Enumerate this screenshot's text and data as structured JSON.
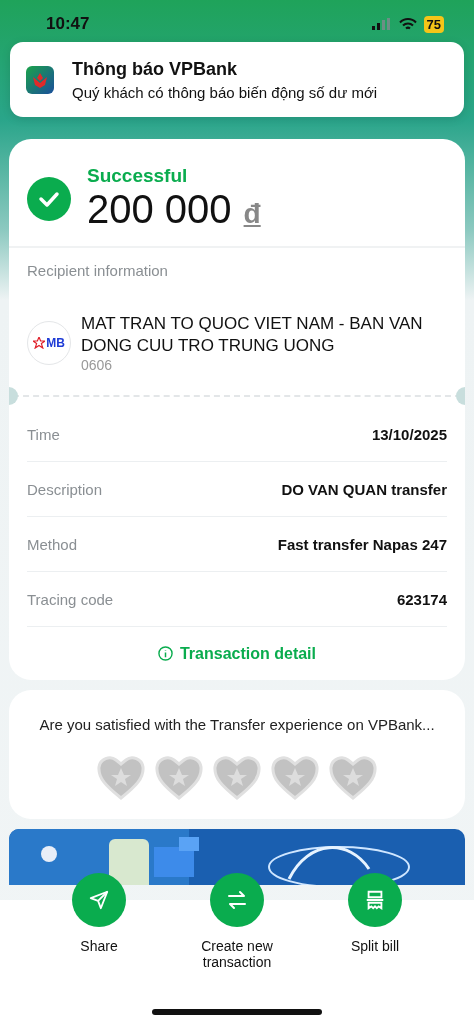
{
  "status_bar": {
    "time": "10:47",
    "battery": "75"
  },
  "notification": {
    "title": "Thông báo VPBank",
    "message": "Quý khách có thông báo biến động số dư mới"
  },
  "receipt": {
    "status": "Successful",
    "amount": "200 000",
    "currency": "đ",
    "recipient_label": "Recipient information",
    "recipient_name": "MAT TRAN TO QUOC VIET NAM - BAN VAN DONG CUU TRO TRUNG UONG",
    "recipient_account": "0606",
    "bank_logo": "MB",
    "details": [
      {
        "label": "Time",
        "value": "13/10/2025"
      },
      {
        "label": "Description",
        "value": "DO VAN QUAN transfer"
      },
      {
        "label": "Method",
        "value": "Fast transfer Napas 247"
      },
      {
        "label": "Tracing code",
        "value": "623174"
      }
    ],
    "detail_link": "Transaction detail"
  },
  "survey": {
    "question": "Are you satisfied with the Transfer experience on VPBank...",
    "stars": 0
  },
  "actions": [
    {
      "kind": "share",
      "label": "Share"
    },
    {
      "kind": "transfer",
      "label": "Create new transaction"
    },
    {
      "kind": "split",
      "label": "Split bill"
    }
  ]
}
